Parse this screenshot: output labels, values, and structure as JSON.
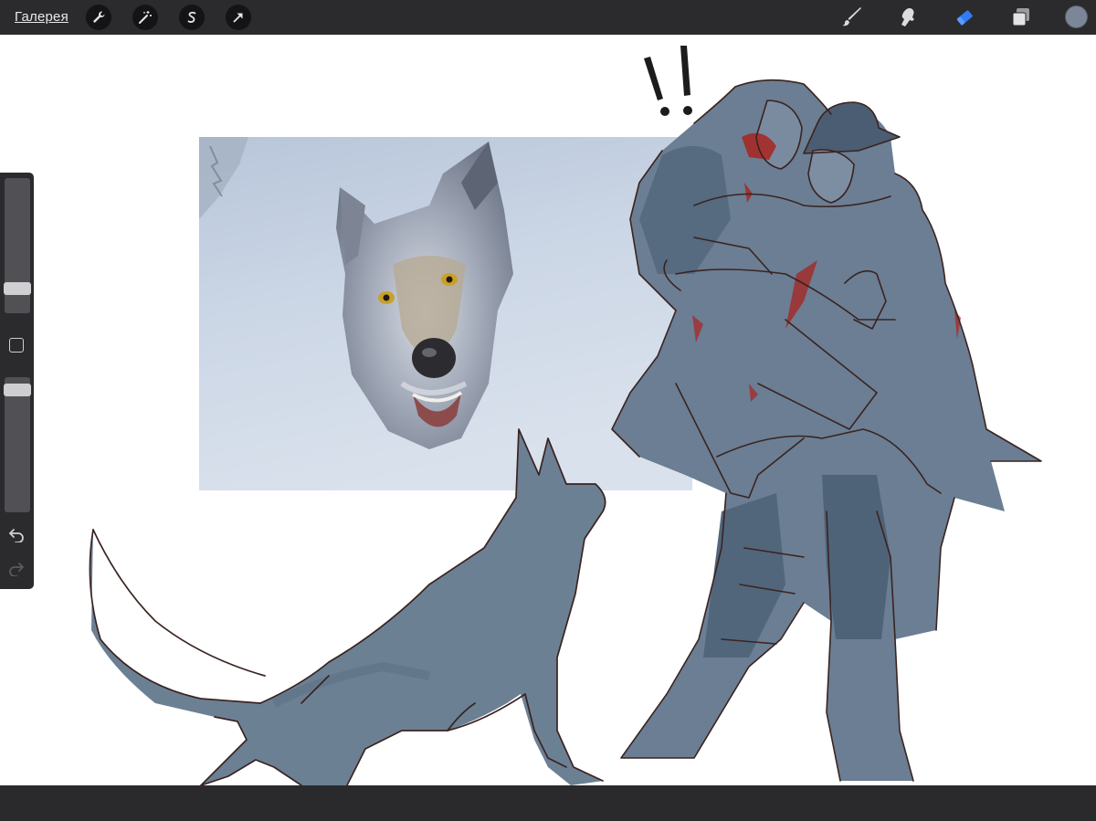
{
  "topbar": {
    "gallery_label": "Галерея",
    "left_tools": [
      "actions-wrench-icon",
      "adjustments-magic-wand-icon",
      "selection-icon",
      "transform-arrow-icon"
    ],
    "right_tools": [
      "brush-icon",
      "smudge-icon",
      "eraser-icon",
      "layers-icon"
    ],
    "active_tool": "eraser",
    "active_tool_color": "#2f7cf6",
    "current_color": "#7b8799"
  },
  "canvas": {
    "annotation_text": "!!",
    "line_color": "#3a2320",
    "fill_color": "#6c8094",
    "blood_color": "#a8231f",
    "photo_tint": "#c9d4e2"
  },
  "sidebar": {
    "brush_size_level": 0.15,
    "opacity_level": 0.95,
    "modify_button": "modify-square-icon",
    "undo": "undo-icon",
    "redo": "redo-icon"
  }
}
